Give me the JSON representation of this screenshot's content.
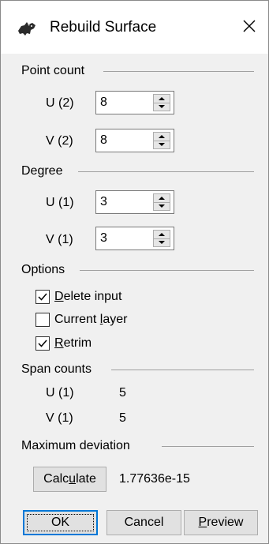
{
  "window": {
    "title": "Rebuild Surface",
    "icon": "rhino-icon",
    "close_icon": "close-icon"
  },
  "point_count": {
    "label": "Point count",
    "u_label": "U (2)",
    "u_value": "8",
    "v_label": "V (2)",
    "v_value": "8"
  },
  "degree": {
    "label": "Degree",
    "u_label": "U (1)",
    "u_value": "3",
    "v_label": "V (1)",
    "v_value": "3"
  },
  "options": {
    "label": "Options",
    "delete_input": {
      "mnemonic": "D",
      "rest": "elete input",
      "checked": true
    },
    "current_layer": {
      "pre": "Current ",
      "mnemonic": "l",
      "rest": "ayer",
      "checked": false
    },
    "retrim": {
      "mnemonic": "R",
      "rest": "etrim",
      "checked": true
    }
  },
  "span_counts": {
    "label": "Span counts",
    "u_label": "U (1)",
    "u_value": "5",
    "v_label": "V (1)",
    "v_value": "5"
  },
  "max_deviation": {
    "label": "Maximum deviation",
    "calculate_pre": "Calc",
    "calculate_mnemonic": "u",
    "calculate_rest": "late",
    "value": "1.77636e-15"
  },
  "buttons": {
    "ok": "OK",
    "cancel": "Cancel",
    "preview_mnemonic": "P",
    "preview_rest": "review"
  },
  "colors": {
    "dialog_bg": "#f0f0f0",
    "title_bg": "#ffffff",
    "default_button_border": "#0078d7"
  }
}
